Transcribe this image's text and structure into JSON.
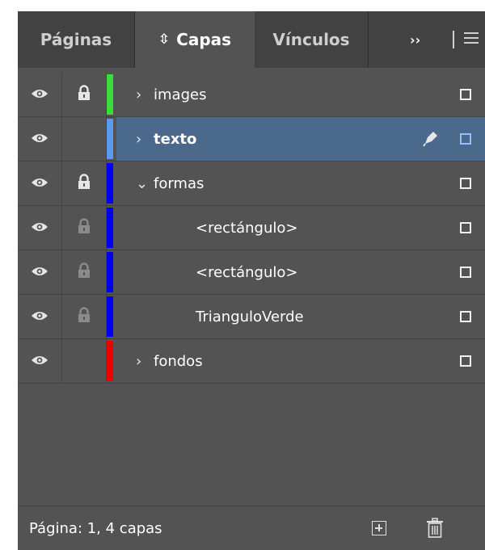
{
  "tabs": [
    {
      "label": "Páginas",
      "active": false
    },
    {
      "label": "Capas",
      "active": true,
      "icon": "sort-arrows-icon"
    },
    {
      "label": "Vínculos",
      "active": false
    }
  ],
  "overflow_label": "››",
  "layers": [
    {
      "name": "images",
      "visible": true,
      "locked": "locked",
      "color": "#3bdc3b",
      "expander": "›",
      "indent": 0,
      "bold": false,
      "selected": false
    },
    {
      "name": "texto",
      "visible": true,
      "locked": "none",
      "color": "#5b9bef",
      "expander": "›",
      "indent": 0,
      "bold": true,
      "selected": true
    },
    {
      "name": "formas",
      "visible": true,
      "locked": "locked",
      "color": "#0000ee",
      "expander": "⌄",
      "indent": 0,
      "bold": false,
      "selected": false
    },
    {
      "name": "<rectángulo>",
      "visible": true,
      "locked": "dim",
      "color": "#0000ee",
      "expander": "",
      "indent": 2,
      "bold": false,
      "selected": false
    },
    {
      "name": "<rectángulo>",
      "visible": true,
      "locked": "dim",
      "color": "#0000ee",
      "expander": "",
      "indent": 2,
      "bold": false,
      "selected": false
    },
    {
      "name": "TrianguloVerde",
      "visible": true,
      "locked": "dim",
      "color": "#0000ee",
      "expander": "",
      "indent": 2,
      "bold": false,
      "selected": false
    },
    {
      "name": "fondos",
      "visible": true,
      "locked": "none",
      "color": "#ee0000",
      "expander": "›",
      "indent": 0,
      "bold": false,
      "selected": false
    }
  ],
  "footer": {
    "status": "Página: 1, 4 capas"
  },
  "colors": {
    "panel_bg": "#535353",
    "tabbar_bg": "#424242",
    "selection": "#4b6a8b"
  }
}
